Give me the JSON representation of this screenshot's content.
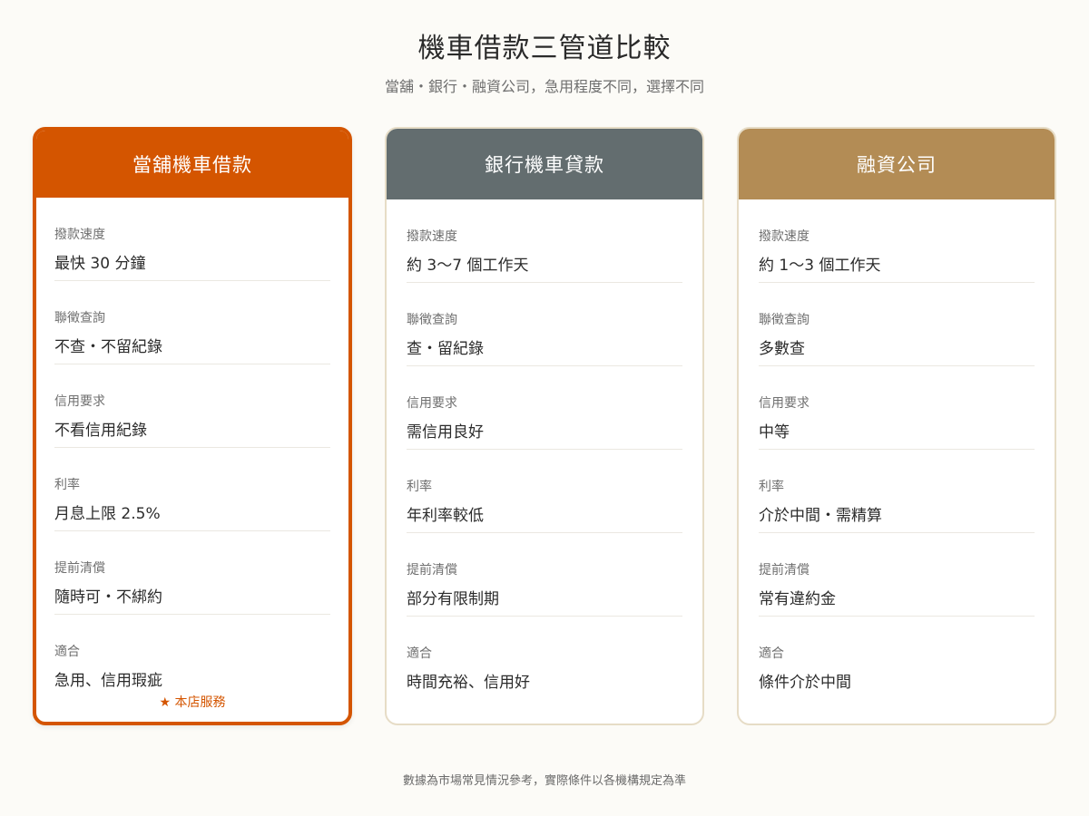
{
  "title": "機車借款三管道比較",
  "subtitle": "當舖・銀行・融資公司，急用程度不同，選擇不同",
  "cards": [
    {
      "name": "當舖機車借款",
      "header_color": "#d45500",
      "highlight": true,
      "badge": "★ 本店服務",
      "rows": [
        {
          "label": "撥款速度",
          "value": "最快 30 分鐘"
        },
        {
          "label": "聯徵查詢",
          "value": "不查・不留紀錄"
        },
        {
          "label": "信用要求",
          "value": "不看信用紀錄"
        },
        {
          "label": "利率",
          "value": "月息上限 2.5%"
        },
        {
          "label": "提前清償",
          "value": "隨時可・不綁約"
        },
        {
          "label": "適合",
          "value": "急用、信用瑕疵"
        }
      ]
    },
    {
      "name": "銀行機車貸款",
      "header_color": "#636d6f",
      "highlight": false,
      "rows": [
        {
          "label": "撥款速度",
          "value": "約 3～7 個工作天"
        },
        {
          "label": "聯徵查詢",
          "value": "查・留紀錄"
        },
        {
          "label": "信用要求",
          "value": "需信用良好"
        },
        {
          "label": "利率",
          "value": "年利率較低"
        },
        {
          "label": "提前清償",
          "value": "部分有限制期"
        },
        {
          "label": "適合",
          "value": "時間充裕、信用好"
        }
      ]
    },
    {
      "name": "融資公司",
      "header_color": "#b38c55",
      "highlight": false,
      "rows": [
        {
          "label": "撥款速度",
          "value": "約 1～3 個工作天"
        },
        {
          "label": "聯徵查詢",
          "value": "多數查"
        },
        {
          "label": "信用要求",
          "value": "中等"
        },
        {
          "label": "利率",
          "value": "介於中間・需精算"
        },
        {
          "label": "提前清償",
          "value": "常有違約金"
        },
        {
          "label": "適合",
          "value": "條件介於中間"
        }
      ]
    }
  ],
  "footer": "數據為市場常見情況參考，實際條件以各機構規定為準"
}
